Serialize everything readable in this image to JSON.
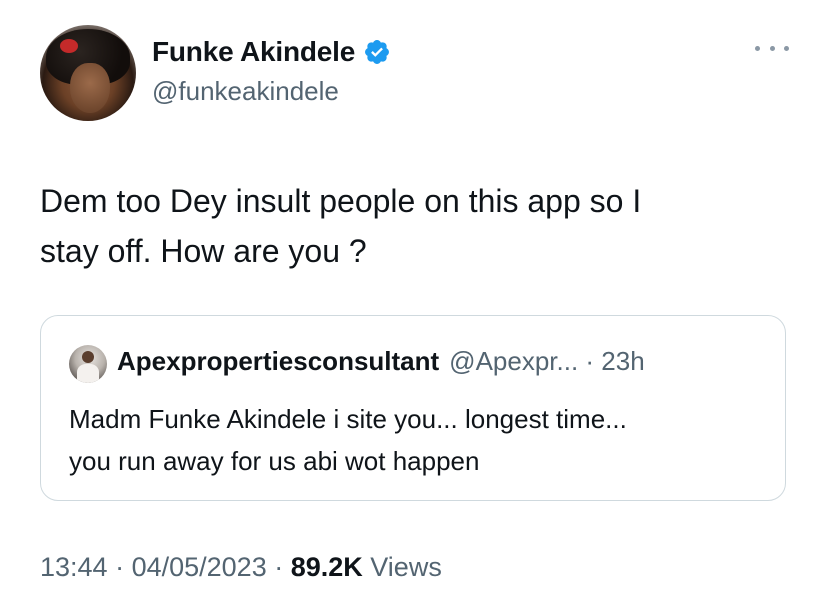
{
  "tweet": {
    "author_name": "Funke Akindele",
    "author_handle": "@funkeakindele",
    "verified_color": "#1d9bf0",
    "text_line1": "Dem too Dey insult people on this app so I",
    "text_line2": "stay off. How are you ?",
    "more_icon": "more-horizontal-icon"
  },
  "quoted_tweet": {
    "author_name": "Apexpropertiesconsultant",
    "meta": "@Apexpr... · 23h",
    "text_line1": "Madm Funke Akindele i site you... longest time...",
    "text_line2": "you run away  for us abi wot happen"
  },
  "footer": {
    "time": "13:44",
    "sep1": " · ",
    "date": "04/05/2023",
    "sep2": " · ",
    "views_count": "89.2K",
    "views_label": " Views"
  }
}
